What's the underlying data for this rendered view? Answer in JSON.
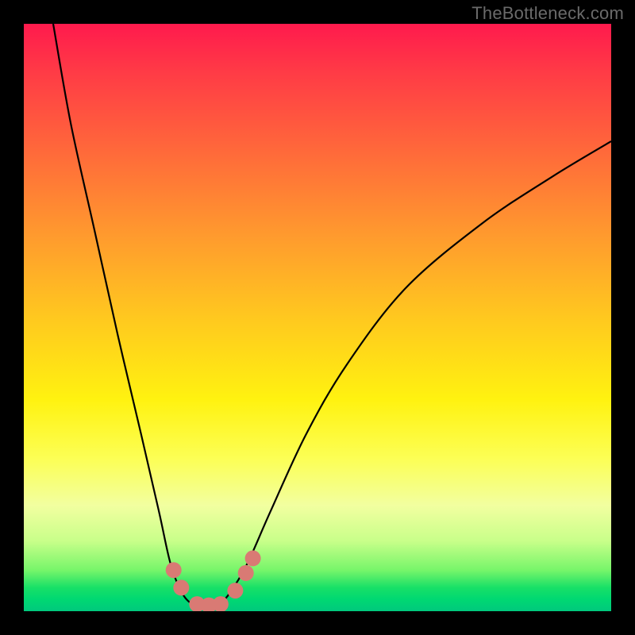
{
  "watermark": "TheBottleneck.com",
  "chart_data": {
    "type": "line",
    "title": "",
    "xlabel": "",
    "ylabel": "",
    "xlim": [
      0,
      100
    ],
    "ylim": [
      0,
      100
    ],
    "series": [
      {
        "name": "bottleneck-curve",
        "x": [
          5,
          8,
          12,
          16,
          20,
          23,
          25,
          27,
          29,
          31,
          33,
          35,
          38,
          42,
          48,
          55,
          65,
          78,
          90,
          100
        ],
        "y": [
          100,
          83,
          65,
          47,
          30,
          17,
          8,
          3,
          1,
          0.5,
          1,
          3,
          8,
          17,
          30,
          42,
          55,
          66,
          74,
          80
        ]
      }
    ],
    "markers": {
      "name": "highlight-points",
      "color": "#d97a74",
      "points": [
        {
          "x": 25.5,
          "y": 7.0
        },
        {
          "x": 26.8,
          "y": 4.0
        },
        {
          "x": 29.5,
          "y": 1.2
        },
        {
          "x": 31.5,
          "y": 1.0
        },
        {
          "x": 33.5,
          "y": 1.2
        },
        {
          "x": 36.0,
          "y": 3.5
        },
        {
          "x": 37.8,
          "y": 6.5
        },
        {
          "x": 39.0,
          "y": 9.0
        }
      ]
    },
    "background_gradient": {
      "top": "#ff1a4d",
      "mid": "#fff210",
      "bottom": "#00c97d"
    }
  }
}
